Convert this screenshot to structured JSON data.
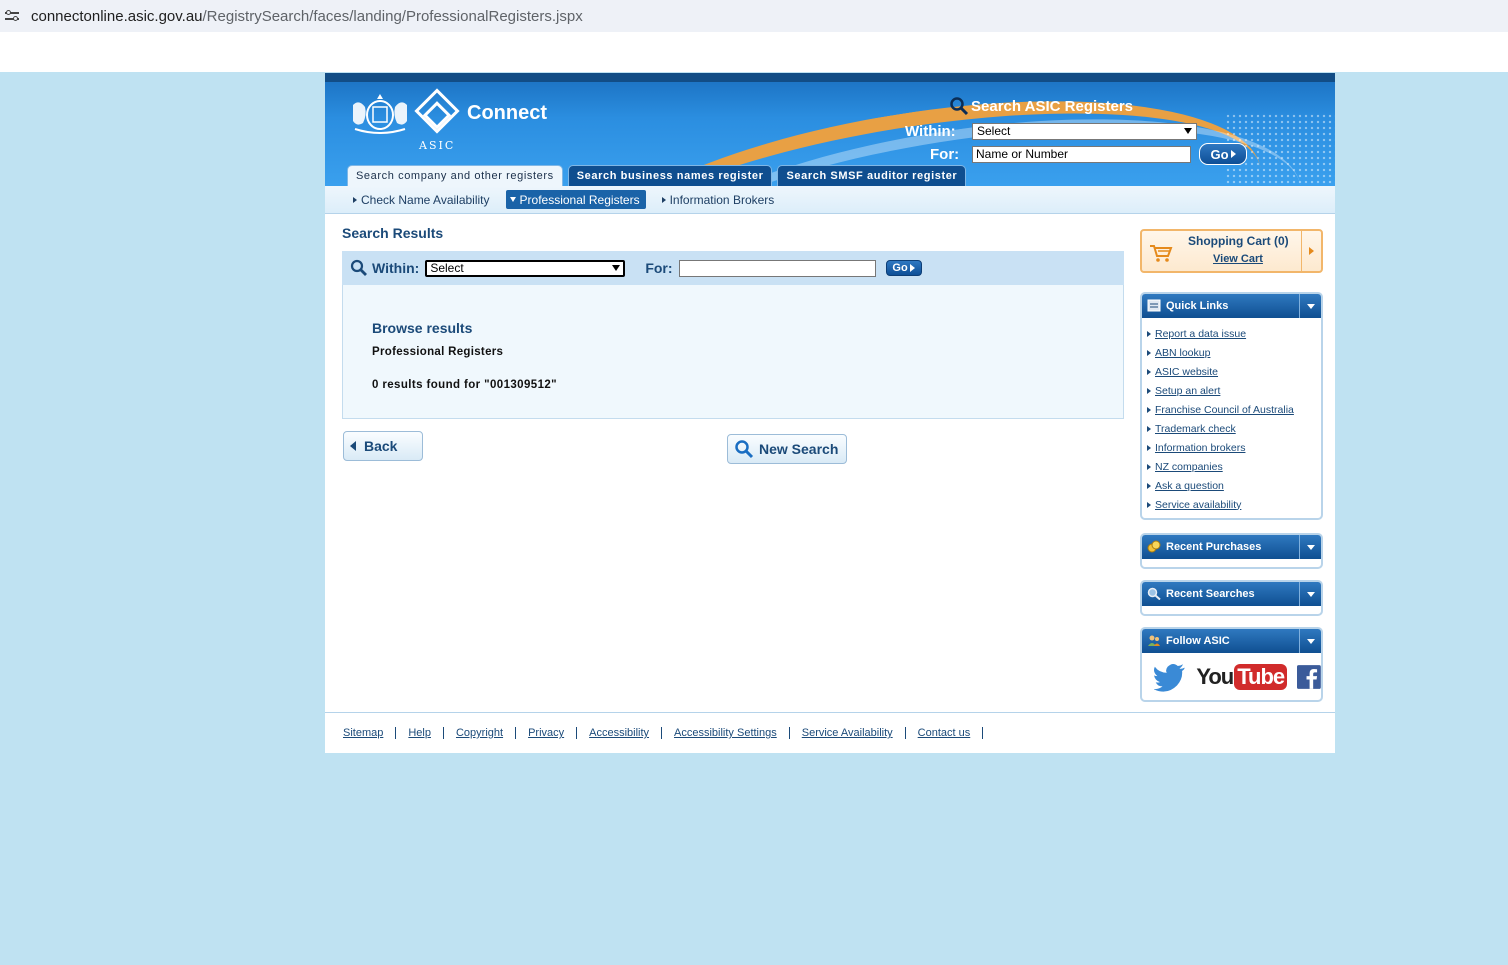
{
  "browser": {
    "url_host": "connectonline.asic.gov.au",
    "url_path": "/RegistrySearch/faces/landing/ProfessionalRegisters.jspx"
  },
  "header": {
    "brand": "Connect",
    "org": "ASIC",
    "search_title": "Search ASIC Registers",
    "within_label": "Within:",
    "within_value": "Select",
    "for_label": "For:",
    "for_placeholder": "Name or Number",
    "go_label": "Go",
    "tabs": [
      {
        "label": "Search company and other registers",
        "active": true
      },
      {
        "label": "Search business names register",
        "active": false
      },
      {
        "label": "Search SMSF auditor register",
        "active": false
      }
    ]
  },
  "subnav": [
    {
      "label": "Check Name Availability",
      "active": false
    },
    {
      "label": "Professional Registers",
      "active": true
    },
    {
      "label": "Information Brokers",
      "active": false
    }
  ],
  "main": {
    "title": "Search Results",
    "within_label": "Within:",
    "within_value": "Select",
    "for_label": "For:",
    "for_value": "",
    "go_label": "Go",
    "result_heading": "Browse results",
    "result_register": "Professional Registers",
    "result_count_text": "0 results found for \"001309512\"",
    "back_label": "Back",
    "new_search_label": "New Search"
  },
  "sidebar": {
    "cart_title": "Shopping Cart (0)",
    "cart_link": "View Cart",
    "quick_links_title": "Quick Links",
    "quick_links": [
      "Report a data issue",
      "ABN lookup",
      "ASIC website",
      "Setup an alert",
      "Franchise Council of Australia",
      "Trademark check",
      "Information brokers",
      "NZ companies",
      "Ask a question",
      "Service availability"
    ],
    "recent_purchases_title": "Recent Purchases",
    "recent_searches_title": "Recent Searches",
    "follow_title": "Follow ASIC",
    "social": [
      "twitter-icon",
      "youtube-icon",
      "facebook-icon"
    ],
    "youtube_you": "You",
    "youtube_tube": "Tube"
  },
  "footer": {
    "links": [
      "Sitemap",
      "Help",
      "Copyright",
      "Privacy",
      "Accessibility",
      "Accessibility Settings",
      "Service Availability",
      "Contact us"
    ]
  },
  "colors": {
    "page_bg": "#bfe2f2",
    "brand_blue": "#1b4a79",
    "header_blue": "#2b8ee0",
    "accent_orange": "#e8a044"
  }
}
